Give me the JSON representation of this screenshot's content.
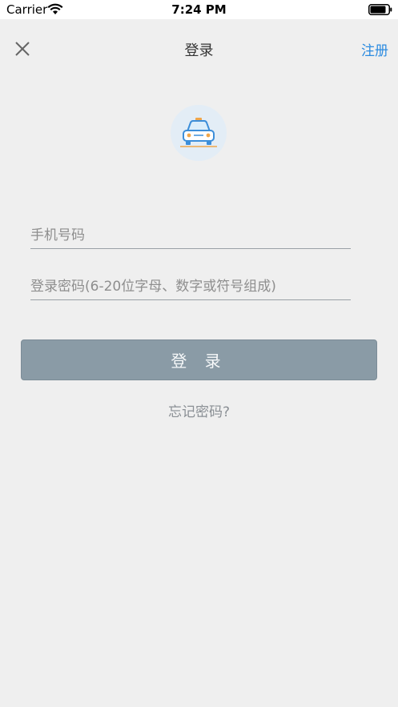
{
  "status_bar": {
    "carrier": "Carrier",
    "time": "7:24 PM",
    "wifi_icon": "wifi-icon",
    "battery_icon": "battery-icon"
  },
  "nav": {
    "close_icon": "close-icon",
    "title": "登录",
    "register_label": "注册"
  },
  "logo": {
    "icon": "taxi-icon"
  },
  "form": {
    "phone_placeholder": "手机号码",
    "phone_value": "",
    "password_placeholder": "登录密码(6-20位字母、数字或符号组成)",
    "password_value": "",
    "login_label": "登 录",
    "forgot_label": "忘记密码?"
  },
  "colors": {
    "background": "#efefef",
    "accent": "#2b8be0",
    "button": "#8a9ba6"
  }
}
